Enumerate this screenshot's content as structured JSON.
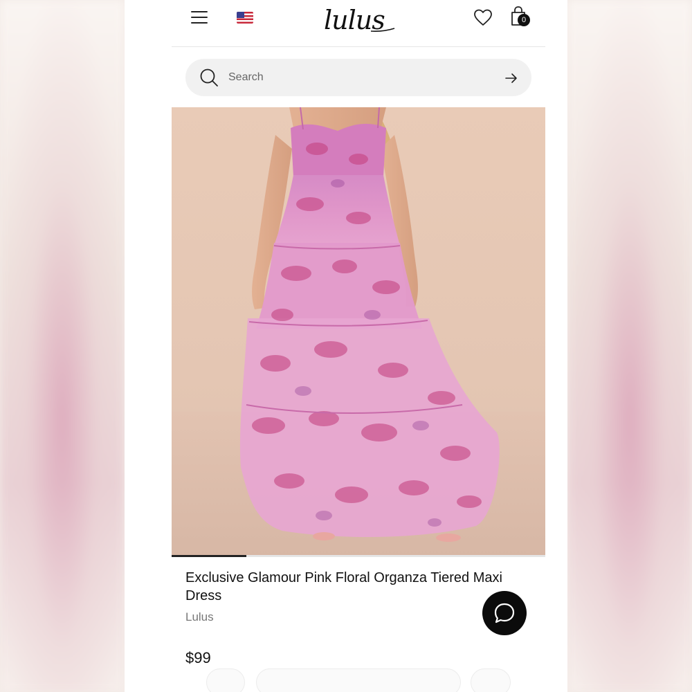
{
  "header": {
    "menu_icon": "hamburger-menu-icon",
    "flag_icon": "us-flag-icon",
    "logo_text": "lulus",
    "wishlist_icon": "heart-icon",
    "cart_icon": "shopping-bag-icon",
    "cart_count": "0"
  },
  "search": {
    "placeholder": "Search",
    "value": "",
    "search_icon": "search-icon",
    "submit_icon": "arrow-right-icon"
  },
  "product": {
    "image_description_icon": "product-photo",
    "gallery_progress": 0.2,
    "title": "Exclusive Glamour Pink Floral Organza Tiered Maxi Dress",
    "brand": "Lulus",
    "price": "$99"
  },
  "chat": {
    "icon": "chat-bubble-icon"
  },
  "colors": {
    "accent": "#111111",
    "dress_pink": "#d58ac4",
    "dress_print": "#c23c7a",
    "backdrop": "#e8c9b6"
  }
}
